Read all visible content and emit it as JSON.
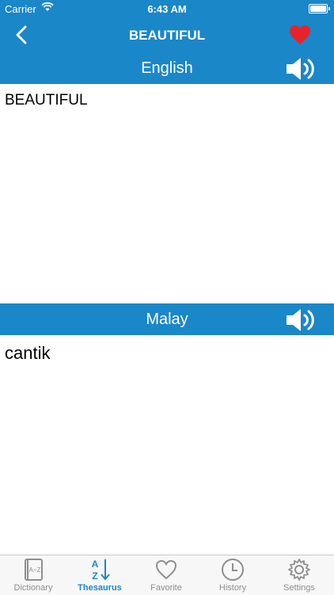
{
  "status": {
    "carrier": "Carrier",
    "time": "6:43 AM",
    "battery_level": 1.0
  },
  "nav": {
    "title": "BEAUTIFUL",
    "favorited": true
  },
  "sections": [
    {
      "language": "English",
      "text": "BEAUTIFUL"
    },
    {
      "language": "Malay",
      "text": "cantik"
    }
  ],
  "tabs": [
    {
      "label": "Dictionary",
      "icon": "dictionary-book-icon",
      "active": false
    },
    {
      "label": "Thesaurus",
      "icon": "az-sort-icon",
      "active": true
    },
    {
      "label": "Favorite",
      "icon": "heart-outline-icon",
      "active": false
    },
    {
      "label": "History",
      "icon": "clock-icon",
      "active": false
    },
    {
      "label": "Settings",
      "icon": "gear-icon",
      "active": false
    }
  ],
  "colors": {
    "primary": "#1a87c9",
    "heart": "#e8212b",
    "tab_inactive": "#8e8e8e"
  }
}
